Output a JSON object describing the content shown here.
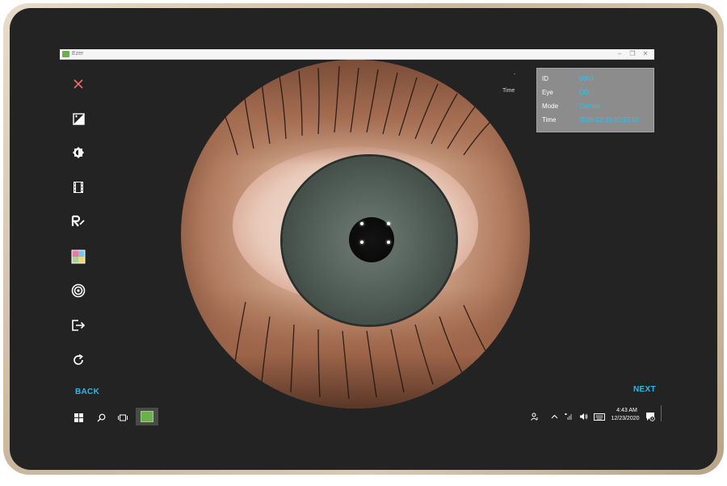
{
  "window": {
    "title": "Ezer",
    "controls": [
      "–",
      "❐",
      "✕"
    ]
  },
  "sidebar": {
    "tools": [
      {
        "name": "close-icon"
      },
      {
        "name": "exposure-icon"
      },
      {
        "name": "brightness-icon"
      },
      {
        "name": "film-icon"
      },
      {
        "name": "report-icon"
      },
      {
        "name": "color-grid-icon"
      },
      {
        "name": "target-icon"
      },
      {
        "name": "export-icon"
      },
      {
        "name": "refresh-icon"
      }
    ]
  },
  "overlay": {
    "dash": "-",
    "time_label": "Time"
  },
  "info": {
    "rows": [
      {
        "key": "ID",
        "value": "0003"
      },
      {
        "key": "Eye",
        "value": "OD"
      },
      {
        "key": "Mode",
        "value": "Cornea"
      },
      {
        "key": "Time",
        "value": "2020-12-23 02:53:52"
      }
    ]
  },
  "nav": {
    "back": "BACK",
    "next": "NEXT"
  },
  "taskbar": {
    "start_icon": "windows-icon",
    "search_icon": "search-icon",
    "taskview_icon": "task-view-icon",
    "clock_time": "4:43 AM",
    "clock_date": "12/23/2020",
    "tray": [
      "person-icon",
      "chevron-up-icon",
      "network-icon",
      "volume-icon",
      "keyboard-icon"
    ],
    "notification_icon": "notification-icon"
  },
  "colors": {
    "accent": "#2fb6f0",
    "info_value": "#1ec8ff",
    "screen_bg": "#232323"
  }
}
